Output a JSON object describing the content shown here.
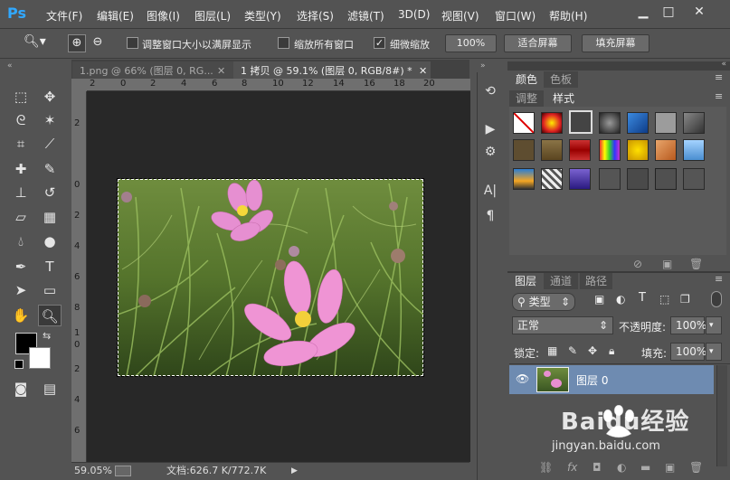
{
  "app": {
    "logo": "Ps"
  },
  "menu": [
    "文件(F)",
    "编辑(E)",
    "图像(I)",
    "图层(L)",
    "类型(Y)",
    "选择(S)",
    "滤镜(T)",
    "3D(D)",
    "视图(V)",
    "窗口(W)",
    "帮助(H)"
  ],
  "window_controls": {
    "minimize": "▁",
    "maximize": "□",
    "close": "✕"
  },
  "options": {
    "resize_windows": "调整窗口大小以满屏显示",
    "zoom_all": "缩放所有窗口",
    "scrubby_zoom": "细微缩放",
    "zoom_value": "100%",
    "fit_screen": "适合屏幕",
    "fill_screen": "填充屏幕"
  },
  "tabs": [
    {
      "label": "1.png @ 66% (图层 0, RG...",
      "close": "✕"
    },
    {
      "label": "1 拷贝 @ 59.1% (图层 0, RGB/8#) *",
      "close": "✕"
    }
  ],
  "ruler_h": [
    "2",
    "0",
    "2",
    "4",
    "6",
    "8",
    "10",
    "12",
    "14",
    "16",
    "18",
    "20"
  ],
  "ruler_v": [
    "2",
    "0",
    "2",
    "4",
    "6",
    "8",
    "1",
    "0",
    "2",
    "4",
    "6"
  ],
  "status": {
    "zoom": "59.05%",
    "doc": "文档:626.7 K/772.7K",
    "arrow": "▶"
  },
  "panel_top": {
    "tab_color": "颜色",
    "tab_swatches": "色板",
    "tab_adjust": "调整",
    "tab_styles": "样式"
  },
  "panel_layers": {
    "tab_layers": "图层",
    "tab_channels": "通道",
    "tab_paths": "路径",
    "filter_kind": "类型",
    "blend_mode": "正常",
    "opacity_label": "不透明度:",
    "opacity_value": "100%",
    "lock_label": "锁定:",
    "fill_label": "填充:",
    "fill_value": "100%",
    "layer_name": "图层 0"
  },
  "watermark": {
    "brand": "Baidu经验",
    "url": "jingyan.baidu.com"
  },
  "colors": {
    "bg": "#535353",
    "canvas": "#282828",
    "selected_layer": "#6e8bb1"
  }
}
